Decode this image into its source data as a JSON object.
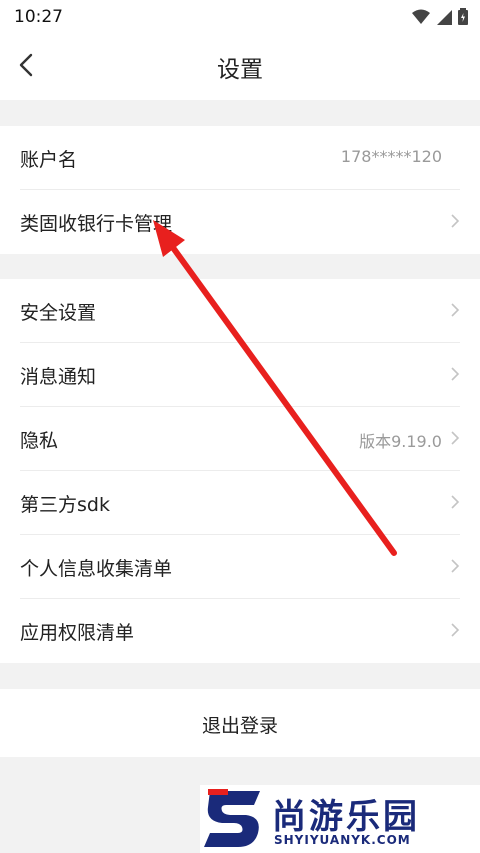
{
  "status_bar": {
    "time": "10:27"
  },
  "header": {
    "title": "设置"
  },
  "account_group": {
    "items": [
      {
        "label": "账户名",
        "value": "178*****120"
      },
      {
        "label": "类固收银行卡管理",
        "value": ""
      }
    ]
  },
  "settings_group": {
    "items": [
      {
        "label": "安全设置",
        "value": ""
      },
      {
        "label": "消息通知",
        "value": ""
      },
      {
        "label": "隐私",
        "value": "版本9.19.0"
      },
      {
        "label": "第三方sdk",
        "value": ""
      },
      {
        "label": "个人信息收集清单",
        "value": ""
      },
      {
        "label": "应用权限清单",
        "value": ""
      }
    ]
  },
  "logout_label": "退出登录",
  "watermark": {
    "text": "尚游乐园",
    "sub": "SHYIYUANYK.COM"
  },
  "colors": {
    "arrow": "#e8201e",
    "watermark": "#1a2a7a"
  }
}
